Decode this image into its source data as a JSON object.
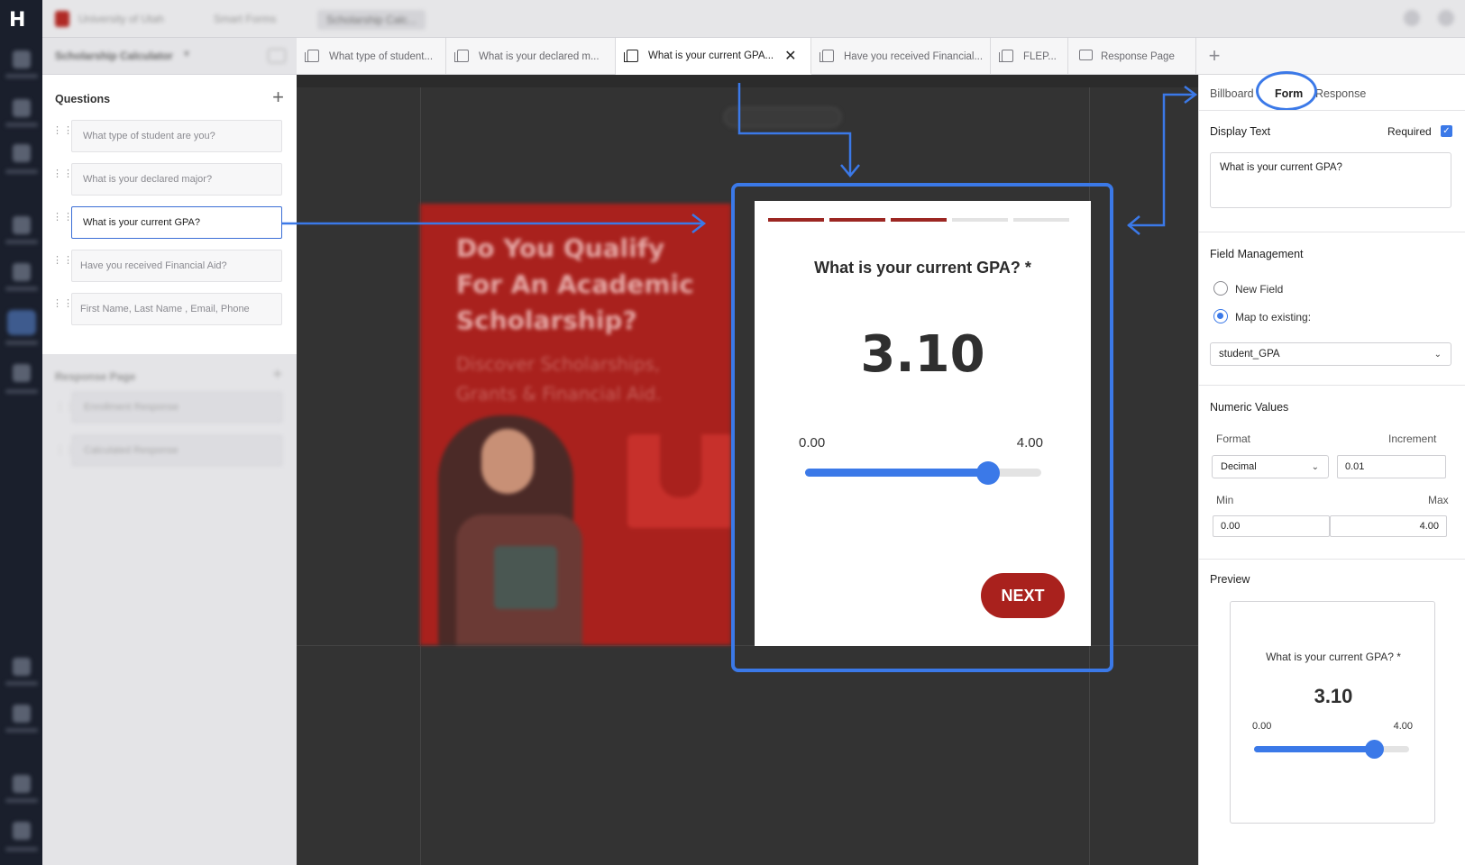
{
  "topbar": {
    "breadcrumb": [
      "University of Utah",
      "Smart Forms",
      "Scholarship Calc..."
    ]
  },
  "left_header": {
    "title": "Scholarship Calculator"
  },
  "tabs": [
    {
      "label": "What type of student...",
      "icon": "page-icon",
      "active": false
    },
    {
      "label": "What is your declared m...",
      "icon": "page-icon",
      "active": false
    },
    {
      "label": "What is your current GPA...",
      "icon": "page-icon",
      "active": true,
      "close": "✕"
    },
    {
      "label": "Have you received Financial...",
      "icon": "page-icon",
      "active": false
    },
    {
      "label": "FLEP...",
      "icon": "page-icon",
      "active": false
    },
    {
      "label": "Response Page",
      "icon": "chat-icon",
      "active": false
    },
    {
      "label": "+",
      "icon": "plus-icon"
    }
  ],
  "questions": {
    "title": "Questions",
    "add": "+",
    "items": [
      "What type of student are you?",
      "What is your declared major?",
      "What is your current GPA?",
      "Have you received Financial Aid?",
      "First Name, Last Name , Email, Phone"
    ],
    "selected_index": 2
  },
  "response_section": {
    "title": "Response Page",
    "items": [
      "Enrollment Response",
      "Calculated Response"
    ]
  },
  "billboard": {
    "headline": "Do You Qualify For An Academic Scholarship?",
    "subhead": "Discover Scholarships, Grants & Financial Aid."
  },
  "form_preview": {
    "question": "What is your current GPA? *",
    "value": "3.10",
    "min_label": "0.00",
    "max_label": "4.00",
    "fraction": 0.775,
    "next_label": "NEXT",
    "progress_segments": [
      {
        "color": "#9c2622"
      },
      {
        "color": "#9c2622"
      },
      {
        "color": "#9c2622"
      },
      {
        "color": "#e3e3e3"
      },
      {
        "color": "#e3e3e3"
      }
    ]
  },
  "right_panel": {
    "tabs": [
      "Billboard",
      "Form",
      "Response"
    ],
    "active_tab": "Form",
    "display_text_label": "Display Text",
    "required_label": "Required",
    "required_checked": true,
    "display_text_value": "What is your current GPA?",
    "field_management_label": "Field Management",
    "new_field_label": "New Field",
    "map_existing_label": "Map to existing:",
    "mapped_field": "student_GPA",
    "numeric_values_label": "Numeric Values",
    "format_label": "Format",
    "increment_label": "Increment",
    "format_value": "Decimal",
    "increment_value": "0.01",
    "min_label": "Min",
    "max_label": "Max",
    "min_value": "0.00",
    "max_value": "4.00",
    "preview_label": "Preview",
    "preview": {
      "question": "What is your current GPA? *",
      "value": "3.10",
      "min_label": "0.00",
      "max_label": "4.00",
      "fraction": 0.775
    }
  },
  "colors": {
    "accent": "#3b79e8",
    "brand_red": "#a9211d"
  }
}
